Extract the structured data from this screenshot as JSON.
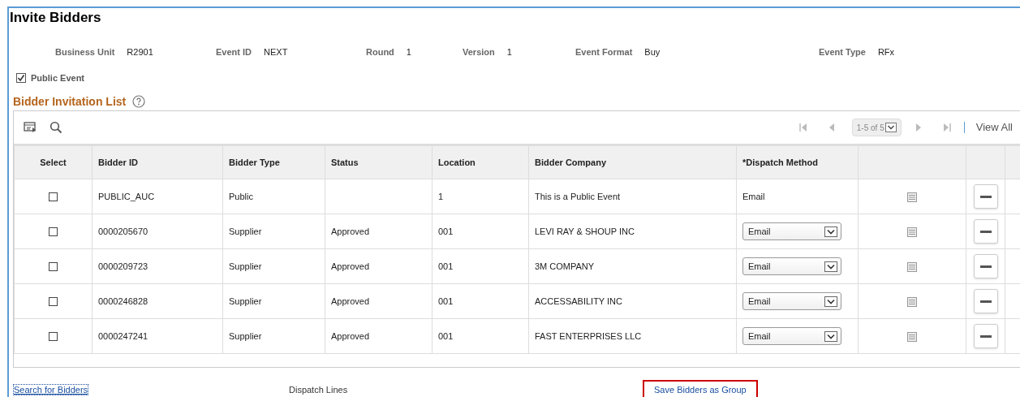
{
  "page_title": "Invite Bidders",
  "fields": [
    {
      "label": "Business Unit",
      "value": "R2901"
    },
    {
      "label": "Event ID",
      "value": "NEXT"
    },
    {
      "label": "Round",
      "value": "1"
    },
    {
      "label": "Version",
      "value": "1"
    },
    {
      "label": "Event Format",
      "value": "Buy"
    },
    {
      "label": "Event Type",
      "value": "RFx"
    }
  ],
  "public_event": {
    "label": "Public Event",
    "checked": true
  },
  "section_title": "Bidder Invitation List",
  "pager": {
    "range": "1-5 of 5",
    "view_all": "View All"
  },
  "table": {
    "columns": [
      "Select",
      "Bidder ID",
      "Bidder Type",
      "Status",
      "Location",
      "Bidder Company",
      "*Dispatch Method"
    ],
    "rows": [
      {
        "checked": false,
        "bidder_id": "PUBLIC_AUC",
        "bidder_type": "Public",
        "location": "1",
        "company": "This is a Public Event",
        "dispatch": {
          "kind": "text",
          "value": "Email"
        }
      },
      {
        "checked": false,
        "bidder_id": "0000205670",
        "bidder_type": "Supplier",
        "status": "Approved",
        "location": "001",
        "company": "LEVI RAY & SHOUP INC",
        "dispatch": {
          "kind": "dropdown",
          "value": "Email"
        }
      },
      {
        "checked": false,
        "bidder_id": "0000209723",
        "bidder_type": "Supplier",
        "status": "Approved",
        "location": "001",
        "company": "3M COMPANY",
        "dispatch": {
          "kind": "dropdown",
          "value": "Email"
        }
      },
      {
        "checked": false,
        "bidder_id": "0000246828",
        "bidder_type": "Supplier",
        "status": "Approved",
        "location": "001",
        "company": "ACCESSABILITY INC",
        "dispatch": {
          "kind": "dropdown",
          "value": "Email"
        }
      },
      {
        "checked": false,
        "bidder_id": "0000247241",
        "bidder_type": "Supplier",
        "status": "Approved",
        "location": "001",
        "company": "FAST ENTERPRISES LLC",
        "dispatch": {
          "kind": "dropdown",
          "value": "Email"
        }
      }
    ]
  },
  "footer": {
    "search_link": "Search for Bidders",
    "dispatch_lines": "Dispatch Lines",
    "save_group": "Save Bidders as Group"
  }
}
